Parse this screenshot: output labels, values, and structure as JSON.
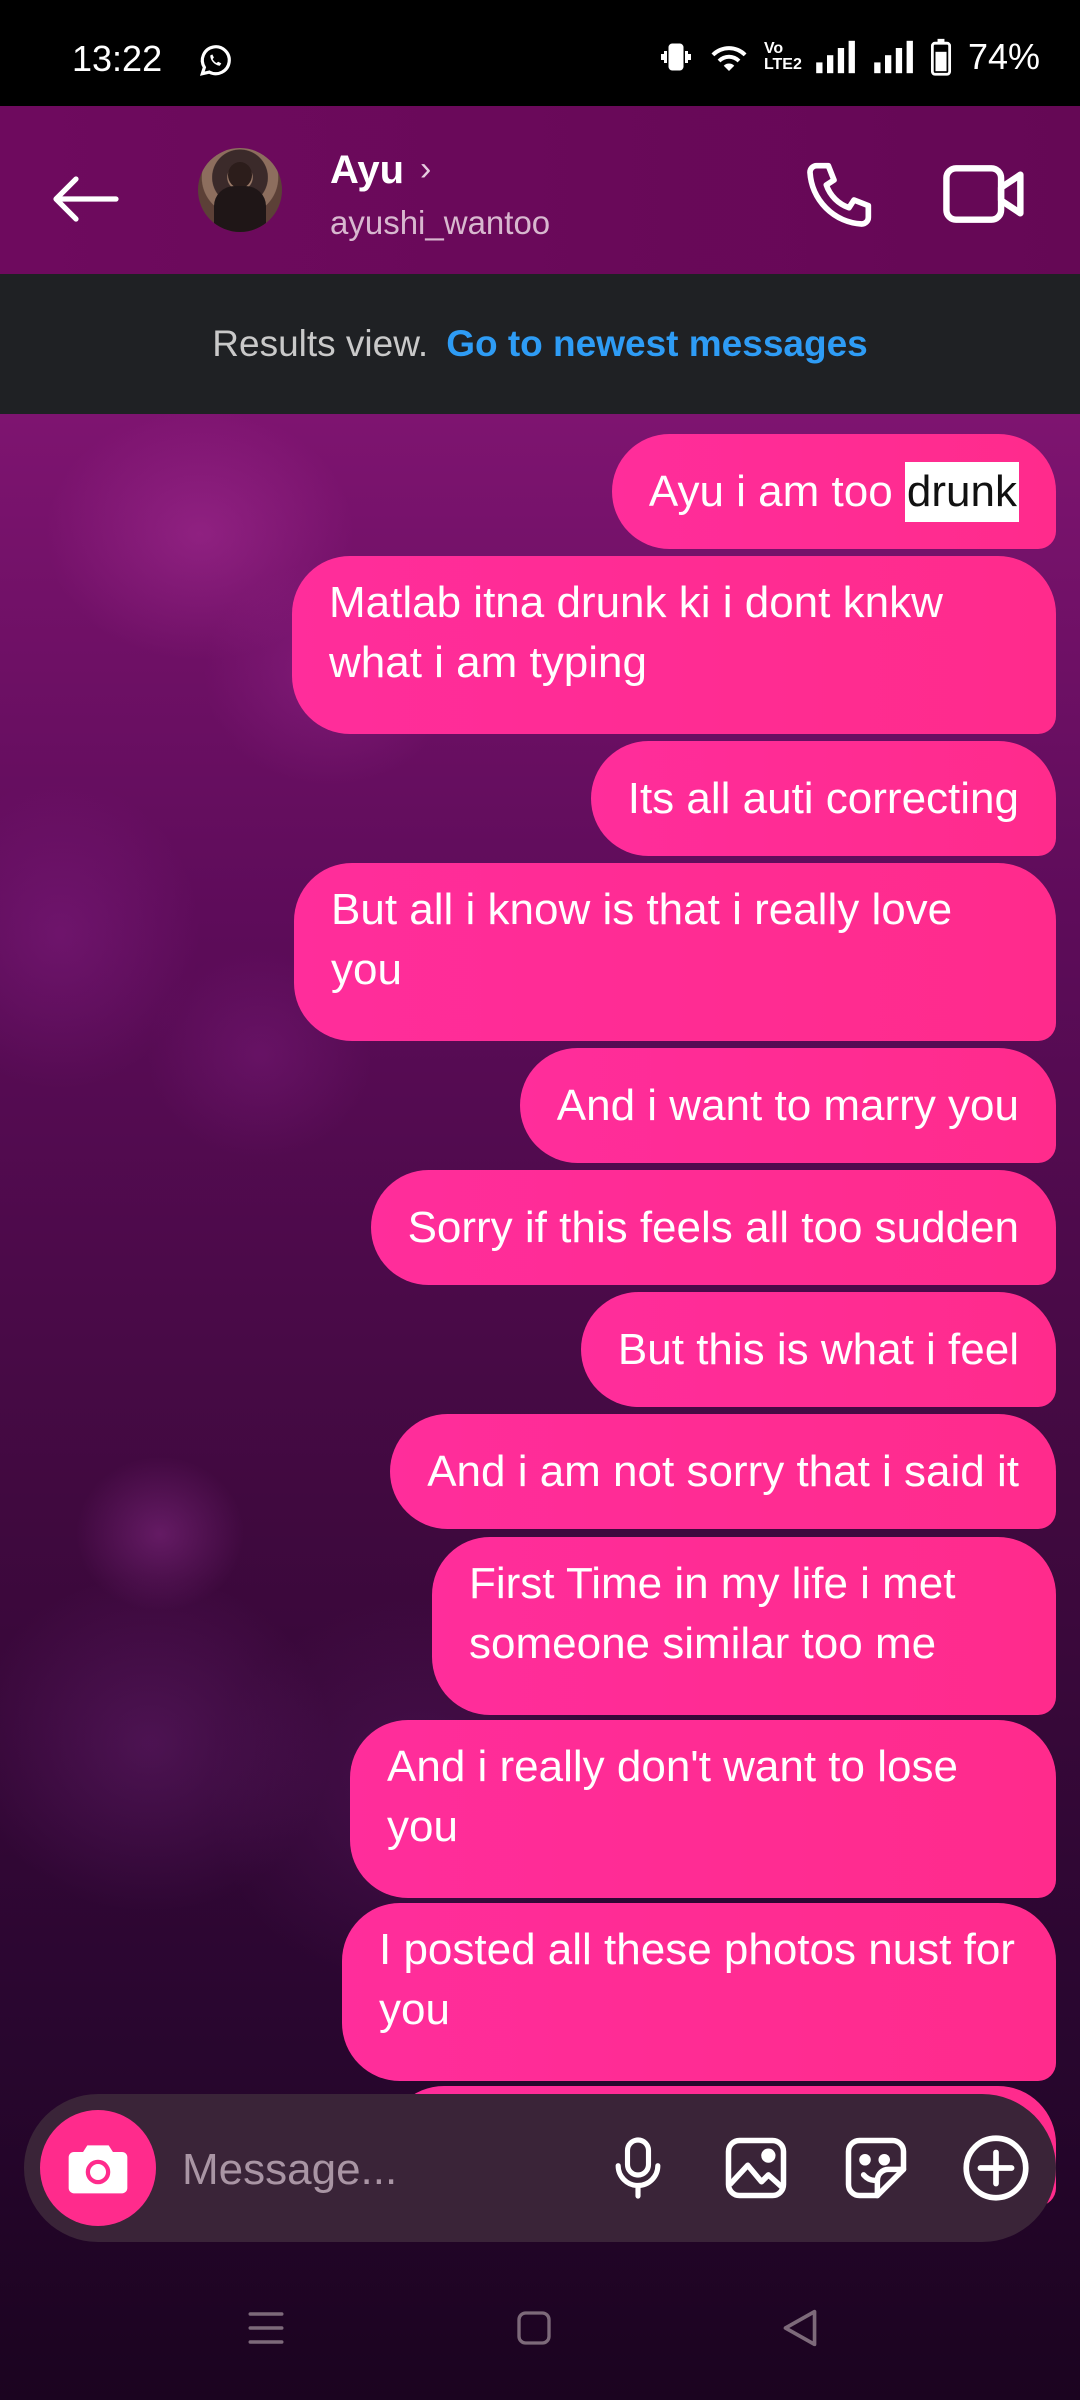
{
  "status_bar": {
    "time": "13:22",
    "battery": "74%",
    "network_label": "Vo LTE2"
  },
  "header": {
    "contact_name": "Ayu",
    "contact_handle": "ayushi_wantoo"
  },
  "results_bar": {
    "label": "Results view.",
    "link": "Go to newest messages"
  },
  "messages": [
    {
      "pre": "Ayu i am too ",
      "highlight": "drunk"
    },
    {
      "text": "Matlab itna drunk ki i dont knkw what i am typing"
    },
    {
      "text": "Its all auti correcting"
    },
    {
      "text": "But all i know is that i really love you"
    },
    {
      "text": "And i want to marry you"
    },
    {
      "text": "Sorry if this feels all too sudden"
    },
    {
      "text": "But this is what i feel"
    },
    {
      "text": "And i am not sorry that i said it"
    },
    {
      "text": "First Time in my life i met someone similar too me"
    },
    {
      "text": "And i really don't want to lose you"
    },
    {
      "text": "I posted all these photos nust for you"
    }
  ],
  "composer": {
    "placeholder": "Message..."
  },
  "colors": {
    "bubble": "#ff2b8c",
    "header": "#6e0a5e",
    "link": "#2e9cf5"
  },
  "icons": [
    "whatsapp-icon",
    "vibrate-icon",
    "wifi-icon",
    "signal-icon",
    "battery-icon",
    "back-arrow-icon",
    "chevron-right-icon",
    "phone-icon",
    "video-icon",
    "camera-icon",
    "microphone-icon",
    "gallery-icon",
    "sticker-icon",
    "plus-circle-icon",
    "menu-icon",
    "home-icon",
    "back-icon"
  ]
}
